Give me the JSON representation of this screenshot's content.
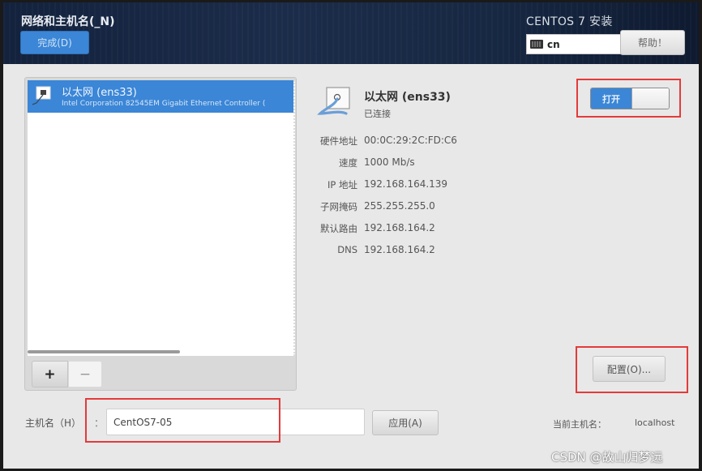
{
  "header": {
    "page_title": "网络和主机名(_N)",
    "done_label": "完成(D)",
    "install_title": "CENTOS 7 安装",
    "keyboard_layout": "cn",
    "help_label": "帮助！"
  },
  "device_list": {
    "items": [
      {
        "name": "以太网 (ens33)",
        "description": "Intel Corporation 82545EM Gigabit Ethernet Controller (",
        "selected": true,
        "icon": "ethernet-icon"
      }
    ],
    "add_label": "+",
    "remove_label": "−"
  },
  "device_detail": {
    "name": "以太网 (ens33)",
    "status": "已连接",
    "icon": "ethernet-cable-icon",
    "properties": [
      {
        "label": "硬件地址",
        "value": "00:0C:29:2C:FD:C6"
      },
      {
        "label": "速度",
        "value": "1000 Mb/s"
      },
      {
        "label": "IP 地址",
        "value": "192.168.164.139"
      },
      {
        "label": "子网掩码",
        "value": "255.255.255.0"
      },
      {
        "label": "默认路由",
        "value": "192.168.164.2"
      },
      {
        "label": "DNS",
        "value": "192.168.164.2"
      }
    ],
    "toggle_label": "打开",
    "toggle_on": true,
    "configure_label": "配置(O)..."
  },
  "hostname": {
    "label": "主机名（H）",
    "colon": "：",
    "value": "CentOS7-05",
    "apply_label": "应用(A)",
    "current_label": "当前主机名：",
    "current_value": "localhost"
  },
  "colors": {
    "accent": "#3b86d6",
    "header_bg": "#172843",
    "highlight_box": "#e43a3a"
  },
  "watermark": "CSDN @故山归梦远"
}
